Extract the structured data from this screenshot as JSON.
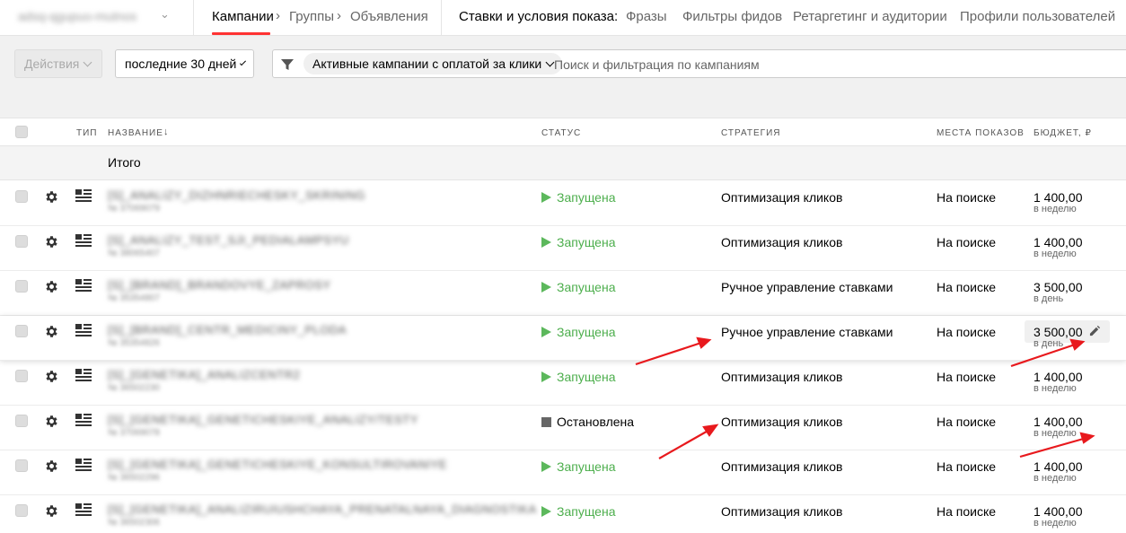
{
  "account": {
    "name": "adsq-qgupuo-mutnos"
  },
  "breadcrumb": {
    "campaigns": "Кампании",
    "groups": "Группы",
    "ads": "Объявления"
  },
  "links": {
    "label": "Ставки и условия показа:",
    "phrases": "Фразы",
    "feed_filters": "Фильтры фидов",
    "retargeting": "Ретаргетинг и аудитории",
    "profiles": "Профили пользователей"
  },
  "toolbar": {
    "actions": "Действия",
    "period": "последние 30 дней",
    "chip": "Активные кампании с оплатой за клики",
    "search_placeholder": "Поиск и фильтрация по кампаниям"
  },
  "columns": {
    "type": "ТИП",
    "name": "НАЗВАНИЕ",
    "sort": "↓",
    "status": "СТАТУС",
    "strategy": "СТРАТЕГИЯ",
    "places": "МЕСТА ПОКАЗОВ",
    "budget": "БЮДЖЕТ, ₽"
  },
  "total_label": "Итого",
  "rows": [
    {
      "name": "[S]_ANALIZY_DIZHNRIECHESKY_SKRINING",
      "id": "№ 37069079",
      "status": "Запущена",
      "status_kind": "running",
      "strategy": "Оптимизация кликов",
      "places": "На поиске",
      "budget": "1 400,00",
      "period": "в неделю"
    },
    {
      "name": "[S]_ANALIZY_TEST_SJI_PEDIALAMPSYU",
      "id": "№ 38065407",
      "status": "Запущена",
      "status_kind": "running",
      "strategy": "Оптимизация кликов",
      "places": "На поиске",
      "budget": "1 400,00",
      "period": "в неделю"
    },
    {
      "name": "[S]_[BRAND]_BRANDOVYE_ZAPROSY",
      "id": "№ 35354807",
      "status": "Запущена",
      "status_kind": "running",
      "strategy": "Ручное управление ставками",
      "places": "На поиске",
      "budget": "3 500,00",
      "period": "в день"
    },
    {
      "name": "[S]_[BRAND]_CENTR_MEDICINY_PLODA",
      "id": "№ 35354826",
      "status": "Запущена",
      "status_kind": "running",
      "strategy": "Ручное управление ставками",
      "places": "На поиске",
      "budget": "3 500,00",
      "period": "в день"
    },
    {
      "name": "[S]_[GENETIKA]_ANALIZCENTR2",
      "id": "№ 36502230",
      "status": "Запущена",
      "status_kind": "running",
      "strategy": "Оптимизация кликов",
      "places": "На поиске",
      "budget": "1 400,00",
      "period": "в неделю"
    },
    {
      "name": "[S]_[GENETIKA]_GENETICHESKIYE_ANALIZY/TESTY",
      "id": "№ 37069078",
      "status": "Остановлена",
      "status_kind": "stopped",
      "strategy": "Оптимизация кликов",
      "places": "На поиске",
      "budget": "1 400,00",
      "period": "в неделю"
    },
    {
      "name": "[S]_[GENETIKA]_GENETICHESKIYE_KONSULTIROVANIYE",
      "id": "№ 36502296",
      "status": "Запущена",
      "status_kind": "running",
      "strategy": "Оптимизация кликов",
      "places": "На поиске",
      "budget": "1 400,00",
      "period": "в неделю"
    },
    {
      "name": "[S]_[GENETIKA]_ANALIZIRUIUSHCHAYA_PRENATALNAYA_DIAGNOSTIKA",
      "id": "№ 36502306",
      "status": "Запущена",
      "status_kind": "running",
      "strategy": "Оптимизация кликов",
      "places": "На поиске",
      "budget": "1 400,00",
      "period": "в неделю"
    }
  ],
  "colors": {
    "accent": "#ff3333",
    "running": "#4cae4c",
    "arrow": "#e8191d"
  }
}
